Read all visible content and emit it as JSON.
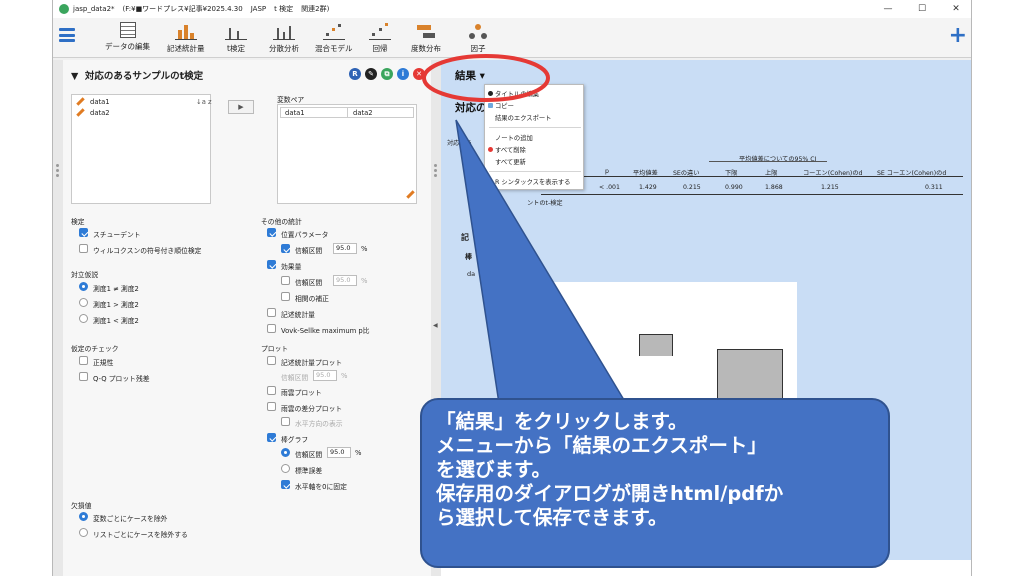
{
  "window": {
    "title_parts": [
      "jasp_data2*",
      "(F:¥■ワードプレス¥記事¥2025.4.30",
      "JASP",
      "t 検定",
      "関連2群)"
    ],
    "controls": {
      "minimize": "—",
      "maximize": "☐",
      "close": "✕"
    }
  },
  "toolbar": {
    "items": [
      "データの編集",
      "記述統計量",
      "t検定",
      "分散分析",
      "混合モデル",
      "回帰",
      "度数分布",
      "因子"
    ]
  },
  "analysis": {
    "title": "対応のあるサンプルのt検定",
    "variables": [
      "data1",
      "data2"
    ],
    "pair_label": "変数ペア",
    "pair": [
      "data1",
      "data2"
    ],
    "test_label": "検定",
    "tests": [
      {
        "label": "スチューデント",
        "checked": true
      },
      {
        "label": "ウィルコクスンの符号付き順位検定",
        "checked": false
      }
    ],
    "alt_label": "対立仮説",
    "alternatives": [
      {
        "label": "測度1 ≠ 測度2",
        "selected": true
      },
      {
        "label": "測度1 > 測度2",
        "selected": false
      },
      {
        "label": "測度1 < 測度2",
        "selected": false
      }
    ],
    "assump_label": "仮定のチェック",
    "assumptions": [
      {
        "label": "正規性",
        "checked": false
      },
      {
        "label": "Q-Q プロット残差",
        "checked": false
      }
    ],
    "missing_label": "欠損値",
    "missing": [
      {
        "label": "変数ごとにケースを除外",
        "selected": true
      },
      {
        "label": "リストごとにケースを除外する",
        "selected": false
      }
    ],
    "other_label": "その他の統計",
    "location_label": "位置パラメータ",
    "ci_label": "信頼区間",
    "ci_value": "95.0",
    "pct": "%",
    "effect_label": "効果量",
    "effect_ci_label": "信頼区間",
    "effect_ci_value": "95.0",
    "corr_label": "相関の補正",
    "desc_label": "記述統計量",
    "vovk_label": "Vovk-Sellke maximum p比",
    "plot_label": "プロット",
    "desc_plot_label": "記述統計量プロット",
    "desc_plot_ci_label": "信頼区間",
    "desc_plot_ci_value": "95.0",
    "raincloud_label": "雨雲プロット",
    "raincloud_diff_label": "雨雲の差分プロット",
    "horizontal_label": "水平方向の表示",
    "bar_label": "棒グラフ",
    "bar_ci_label": "信頼区間",
    "bar_ci_value": "95.0",
    "se_label": "標準誤差",
    "fix_axis_label": "水平軸を0に固定"
  },
  "results": {
    "menu_title": "結果 ▾",
    "section_title": "対応の",
    "sub_label": "対応のあ",
    "ci_group_header": "平均値差についての95% CI",
    "columns": [
      "p",
      "平均値差",
      "SEの違い",
      "下限",
      "上限",
      "コーエン(Cohen)のd",
      "SE コーエン(Cohen)のd"
    ],
    "row": [
      "< .001",
      "1.429",
      "0.215",
      "0.990",
      "1.868",
      "1.215",
      "0.311"
    ],
    "footnote": "ントのt-検定",
    "fragments": {
      "desc": "記",
      "bar": "棒",
      "var": "da"
    },
    "y_ticks": [
      "1.",
      "0.5",
      "0.0",
      "-0.5"
    ]
  },
  "context_menu": [
    {
      "label": "タイトルの編集",
      "icon": "edit-icon"
    },
    {
      "label": "コピー",
      "icon": "copy-icon"
    },
    {
      "label": "結果のエクスポート",
      "icon": ""
    },
    {
      "label": "ノートの追加",
      "icon": ""
    },
    {
      "label": "すべて削除",
      "icon": "delete-icon"
    },
    {
      "label": "すべて更新",
      "icon": ""
    },
    {
      "label": "R シンタックスを表示する",
      "icon": "r-icon"
    }
  ],
  "callout": {
    "lines": [
      "「結果」をクリックします。",
      "メニューから「結果のエクスポート」",
      "を選びます。",
      "保存用のダイアログが開きhtml/pdfか",
      "ら選択して保存できます。"
    ]
  },
  "colors": {
    "accent": "#2e7bd6",
    "highlight_ring": "#e53935",
    "callout": "#4472c4",
    "bar": "#d9822b"
  }
}
